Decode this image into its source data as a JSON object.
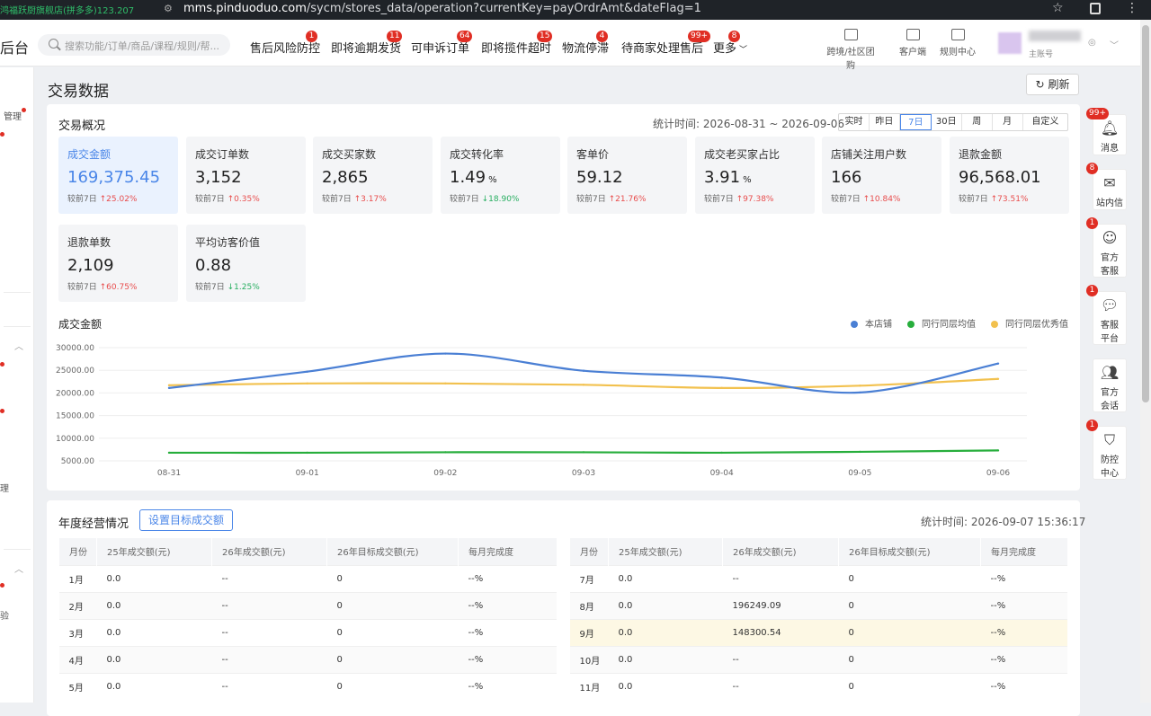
{
  "browser": {
    "left_text": "鸿福跃厨旗舰店(拼多多)123.207",
    "url_host": "mms.pinduoduo.com",
    "url_path": "/sycm/stores_data/operation?currentKey=payOrdrAmt&dateFlag=1"
  },
  "nav": {
    "brand": "后台",
    "search_placeholder": "搜索功能/订单/商品/课程/规则/帮...",
    "items": [
      {
        "label": "售后风险防控",
        "badge": "1"
      },
      {
        "label": "即将逾期发货",
        "badge": "11"
      },
      {
        "label": "可申诉订单",
        "badge": "64"
      },
      {
        "label": "即将揽件超时",
        "badge": "15"
      },
      {
        "label": "物流停滞",
        "badge": "4"
      },
      {
        "label": "待商家处理售后",
        "badge": "99+"
      },
      {
        "label": "更多",
        "badge": "8"
      }
    ],
    "tools": [
      {
        "label": "跨境/社区团购"
      },
      {
        "label": "客户端"
      },
      {
        "label": "规则中心"
      }
    ],
    "account_sub": "主账号"
  },
  "sidebar": {
    "items": [
      "管理",
      "理",
      "验"
    ]
  },
  "page": {
    "title": "交易数据",
    "refresh": "刷新"
  },
  "overview": {
    "title": "交易概况",
    "stat_label": "统计时间:",
    "stat_range": "2026-08-31 ~ 2026-09-06",
    "ranges": [
      "实时",
      "昨日",
      "7日",
      "30日",
      "周",
      "月",
      "自定义"
    ],
    "selected_range": "7日",
    "kpis": [
      {
        "label": "成交金额",
        "value": "169,375.45",
        "unit": "",
        "compare": "较前7日",
        "dir": "up",
        "change": "25.02%"
      },
      {
        "label": "成交订单数",
        "value": "3,152",
        "unit": "",
        "compare": "较前7日",
        "dir": "up",
        "change": "0.35%"
      },
      {
        "label": "成交买家数",
        "value": "2,865",
        "unit": "",
        "compare": "较前7日",
        "dir": "up",
        "change": "3.17%"
      },
      {
        "label": "成交转化率",
        "value": "1.49",
        "unit": "%",
        "compare": "较前7日",
        "dir": "down",
        "change": "18.90%"
      },
      {
        "label": "客单价",
        "value": "59.12",
        "unit": "",
        "compare": "较前7日",
        "dir": "up",
        "change": "21.76%"
      },
      {
        "label": "成交老买家占比",
        "value": "3.91",
        "unit": "%",
        "compare": "较前7日",
        "dir": "up",
        "change": "97.38%"
      },
      {
        "label": "店铺关注用户数",
        "value": "166",
        "unit": "",
        "compare": "较前7日",
        "dir": "up",
        "change": "10.84%"
      },
      {
        "label": "退款金额",
        "value": "96,568.01",
        "unit": "",
        "compare": "较前7日",
        "dir": "up",
        "change": "73.51%"
      },
      {
        "label": "退款单数",
        "value": "2,109",
        "unit": "",
        "compare": "较前7日",
        "dir": "up",
        "change": "60.75%"
      },
      {
        "label": "平均访客价值",
        "value": "0.88",
        "unit": "",
        "compare": "较前7日",
        "dir": "down",
        "change": "1.25%"
      }
    ]
  },
  "chart_data": {
    "type": "line",
    "title": "成交金额",
    "categories": [
      "08-31",
      "09-01",
      "09-02",
      "09-03",
      "09-04",
      "09-05",
      "09-06"
    ],
    "y_ticks": [
      "30000.00",
      "25000.00",
      "20000.00",
      "15000.00",
      "10000.00",
      "5000.00"
    ],
    "ylim": [
      5000,
      30000
    ],
    "legend_position": "top-right",
    "series": [
      {
        "name": "本店铺",
        "color": "#4a7fd4",
        "values": [
          21100,
          24700,
          28700,
          24900,
          23400,
          20100,
          26500
        ]
      },
      {
        "name": "同行同层均值",
        "color": "#27ae3c",
        "values": [
          6800,
          6800,
          6900,
          6900,
          6800,
          7000,
          7300
        ]
      },
      {
        "name": "同行同层优秀值",
        "color": "#f2c14e",
        "values": [
          21700,
          22100,
          22100,
          21800,
          21100,
          21600,
          23100
        ]
      }
    ]
  },
  "annual": {
    "title": "年度经营情况",
    "button": "设置目标成交额",
    "stat_label": "统计时间:",
    "stat_time": "2026-09-07 15:36:17",
    "headers": [
      "月份",
      "25年成交额(元)",
      "26年成交额(元)",
      "26年目标成交额(元)",
      "每月完成度"
    ],
    "left_rows": [
      [
        "1月",
        "0.0",
        "--",
        "0",
        "--%"
      ],
      [
        "2月",
        "0.0",
        "--",
        "0",
        "--%"
      ],
      [
        "3月",
        "0.0",
        "--",
        "0",
        "--%"
      ],
      [
        "4月",
        "0.0",
        "--",
        "0",
        "--%"
      ],
      [
        "5月",
        "0.0",
        "--",
        "0",
        "--%"
      ]
    ],
    "right_rows": [
      [
        "7月",
        "0.0",
        "--",
        "0",
        "--%"
      ],
      [
        "8月",
        "0.0",
        "196249.09",
        "0",
        "--%"
      ],
      [
        "9月",
        "0.0",
        "148300.54",
        "0",
        "--%"
      ],
      [
        "10月",
        "0.0",
        "--",
        "0",
        "--%"
      ],
      [
        "11月",
        "0.0",
        "--",
        "0",
        "--%"
      ]
    ]
  },
  "right_panel": [
    {
      "label": "消息",
      "badge": "99+",
      "icon": "bell-icon"
    },
    {
      "label": "站内信",
      "badge": "8",
      "icon": "mail-icon"
    },
    {
      "label": "官方客服",
      "badge": "1",
      "icon": "robot-icon"
    },
    {
      "label": "客服平台",
      "badge": "1",
      "icon": "chat-icon"
    },
    {
      "label": "官方会话",
      "badge": "",
      "icon": "people-icon"
    },
    {
      "label": "防控中心",
      "badge": "1",
      "icon": "shield-icon"
    }
  ]
}
